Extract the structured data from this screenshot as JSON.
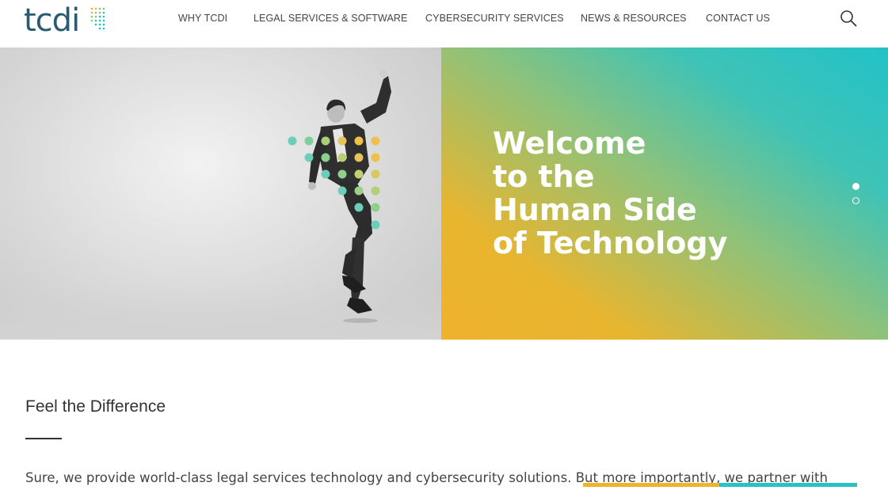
{
  "brand": {
    "name": "tcdi"
  },
  "nav": {
    "items": [
      {
        "label": "WHY TCDI"
      },
      {
        "label": "LEGAL SERVICES & SOFTWARE"
      },
      {
        "label": "CYBERSECURITY SERVICES"
      },
      {
        "label": "NEWS & RESOURCES"
      },
      {
        "label": "CONTACT US"
      }
    ]
  },
  "hero": {
    "title_lines": [
      "Welcome",
      "to the",
      "Human Side",
      "of Technology"
    ],
    "slides": {
      "count": 2,
      "active_index": 0
    }
  },
  "content": {
    "heading": "Feel the Difference",
    "body": "Sure, we provide world-class legal services technology and cybersecurity solutions. But more importantly, we partner with"
  },
  "colors": {
    "brand_teal": "#2b5a72",
    "accent_yellow": "#efb22c",
    "accent_teal": "#22c2c8",
    "accent_green": "#8cc27c"
  },
  "icons": {
    "search": "search-icon",
    "logo_dots": "logo-dots-icon"
  }
}
